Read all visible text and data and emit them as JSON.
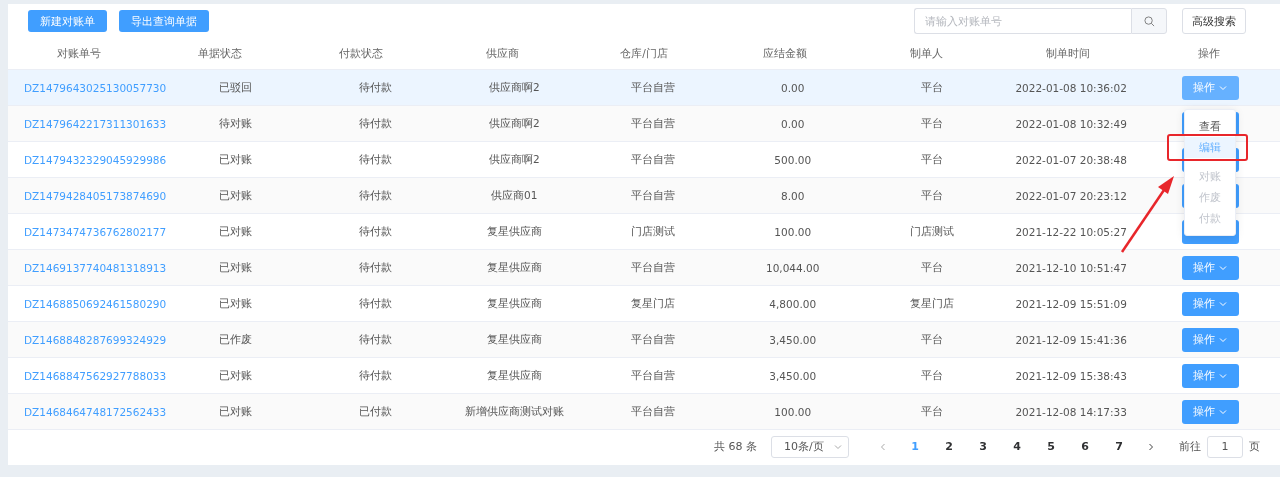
{
  "toolbar": {
    "buttons": [
      "新建对账单",
      "导出查询单据"
    ],
    "search": {
      "placeholder": "请输入对账单号"
    },
    "advanced_button": "高级搜索"
  },
  "table": {
    "columns": [
      "对账单号",
      "单据状态",
      "付款状态",
      "供应商",
      "仓库/门店",
      "应结金额",
      "制单人",
      "制单时间",
      "操作"
    ],
    "rows": [
      {
        "id": "DZ1479643025130057730",
        "status": "已驳回",
        "payment": "待付款",
        "supplier": "供应商啊2",
        "store": "平台自营",
        "amount": "0.00",
        "creator": "平台",
        "time": "2022-01-08 10:36:02",
        "action": "操作",
        "hovered": true
      },
      {
        "id": "DZ1479642217311301633",
        "status": "待对账",
        "payment": "待付款",
        "supplier": "供应商啊2",
        "store": "平台自营",
        "amount": "0.00",
        "creator": "平台",
        "time": "2022-01-08 10:32:49",
        "hovered": false
      },
      {
        "id": "DZ1479432329045929986",
        "status": "已对账",
        "payment": "待付款",
        "supplier": "供应商啊2",
        "store": "平台自营",
        "amount": "500.00",
        "creator": "平台",
        "time": "2022-01-07 20:38:48",
        "hovered": false
      },
      {
        "id": "DZ1479428405173874690",
        "status": "已对账",
        "payment": "待付款",
        "supplier": "供应商01",
        "store": "平台自营",
        "amount": "8.00",
        "creator": "平台",
        "time": "2022-01-07 20:23:12",
        "hovered": false
      },
      {
        "id": "DZ1473474736762802177",
        "status": "已对账",
        "payment": "待付款",
        "supplier": "复星供应商",
        "store": "门店测试",
        "amount": "100.00",
        "creator": "门店测试",
        "time": "2021-12-22 10:05:27",
        "hovered": false
      },
      {
        "id": "DZ1469137740481318913",
        "status": "已对账",
        "payment": "待付款",
        "supplier": "复星供应商",
        "store": "平台自营",
        "amount": "10,044.00",
        "creator": "平台",
        "time": "2021-12-10 10:51:47",
        "action": "操作",
        "hovered": false
      },
      {
        "id": "DZ1468850692461580290",
        "status": "已对账",
        "payment": "待付款",
        "supplier": "复星供应商",
        "store": "复星门店",
        "amount": "4,800.00",
        "creator": "复星门店",
        "time": "2021-12-09 15:51:09",
        "action": "操作",
        "hovered": false
      },
      {
        "id": "DZ1468848287699324929",
        "status": "已作废",
        "payment": "待付款",
        "supplier": "复星供应商",
        "store": "平台自营",
        "amount": "3,450.00",
        "creator": "平台",
        "time": "2021-12-09 15:41:36",
        "action": "操作",
        "hovered": false
      },
      {
        "id": "DZ1468847562927788033",
        "status": "已对账",
        "payment": "待付款",
        "supplier": "复星供应商",
        "store": "平台自营",
        "amount": "3,450.00",
        "creator": "平台",
        "time": "2021-12-09 15:38:43",
        "action": "操作",
        "hovered": false
      },
      {
        "id": "DZ1468464748172562433",
        "status": "已对账",
        "payment": "已付款",
        "supplier": "新增供应商测试对账",
        "store": "平台自营",
        "amount": "100.00",
        "creator": "平台",
        "time": "2021-12-08 14:17:33",
        "action": "操作",
        "hovered": false
      }
    ]
  },
  "dropdown_menu": {
    "items": [
      {
        "label": "查看",
        "highlighted": false,
        "disabled": false
      },
      {
        "label": "编辑",
        "highlighted": true,
        "disabled": false
      },
      {
        "label": "对账",
        "highlighted": false,
        "disabled": true
      },
      {
        "label": "作废",
        "highlighted": false,
        "disabled": true
      },
      {
        "label": "付款",
        "highlighted": false,
        "disabled": true
      }
    ]
  },
  "pagination": {
    "total": "共 68 条",
    "page_size": "10条/页",
    "pages": [
      {
        "label": "1",
        "selected": true
      },
      {
        "label": "2",
        "selected": false
      },
      {
        "label": "3",
        "selected": false
      },
      {
        "label": "4",
        "selected": false
      },
      {
        "label": "5",
        "selected": false
      },
      {
        "label": "6",
        "selected": false
      },
      {
        "label": "7",
        "selected": false
      }
    ],
    "goto_label": "前往",
    "goto_value": "1",
    "goto_suffix": "页"
  }
}
